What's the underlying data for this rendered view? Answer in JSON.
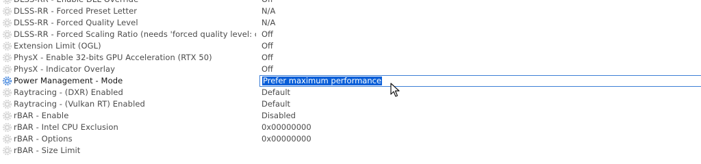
{
  "settings": [
    {
      "name": "DLSS-RR - Enable DLL Override",
      "value": "Off",
      "icon": "gear-icon",
      "active": false
    },
    {
      "name": "DLSS-RR - Forced Preset Letter",
      "value": "N/A",
      "icon": "gear-icon",
      "active": false
    },
    {
      "name": "DLSS-RR - Forced Quality Level",
      "value": "N/A",
      "icon": "gear-icon",
      "active": false
    },
    {
      "name": "DLSS-RR - Forced Scaling Ratio (needs 'forced quality level: c...",
      "value": "Off",
      "icon": "gear-icon",
      "active": false
    },
    {
      "name": "Extension Limit (OGL)",
      "value": "Off",
      "icon": "gear-icon",
      "active": false
    },
    {
      "name": "PhysX - Enable 32-bits GPU Acceleration (RTX 50)",
      "value": "Off",
      "icon": "gear-icon",
      "active": false
    },
    {
      "name": "PhysX - Indicator Overlay",
      "value": "Off",
      "icon": "gear-icon",
      "active": false
    },
    {
      "name": "Power Management - Mode",
      "value": "Prefer maximum performance",
      "icon": "gear-icon",
      "active": true
    },
    {
      "name": "Raytracing - (DXR) Enabled",
      "value": "Default",
      "icon": "gear-icon",
      "active": false
    },
    {
      "name": "Raytracing - (Vulkan RT) Enabled",
      "value": "Default",
      "icon": "gear-icon",
      "active": false
    },
    {
      "name": "rBAR - Enable",
      "value": "Disabled",
      "icon": "gear-icon",
      "active": false
    },
    {
      "name": "rBAR - Intel CPU Exclusion",
      "value": "0x00000000",
      "icon": "gear-icon",
      "active": false
    },
    {
      "name": "rBAR - Options",
      "value": "0x00000000",
      "icon": "gear-icon",
      "active": false
    },
    {
      "name": "rBAR - Size Limit",
      "value": "",
      "icon": "gear-icon",
      "active": false
    }
  ],
  "colors": {
    "inactive_gear": "#c8c8c8",
    "active_gear": "#3b7fd9",
    "selection": "#0a5fd8",
    "editor_border": "#3c7fd6"
  }
}
